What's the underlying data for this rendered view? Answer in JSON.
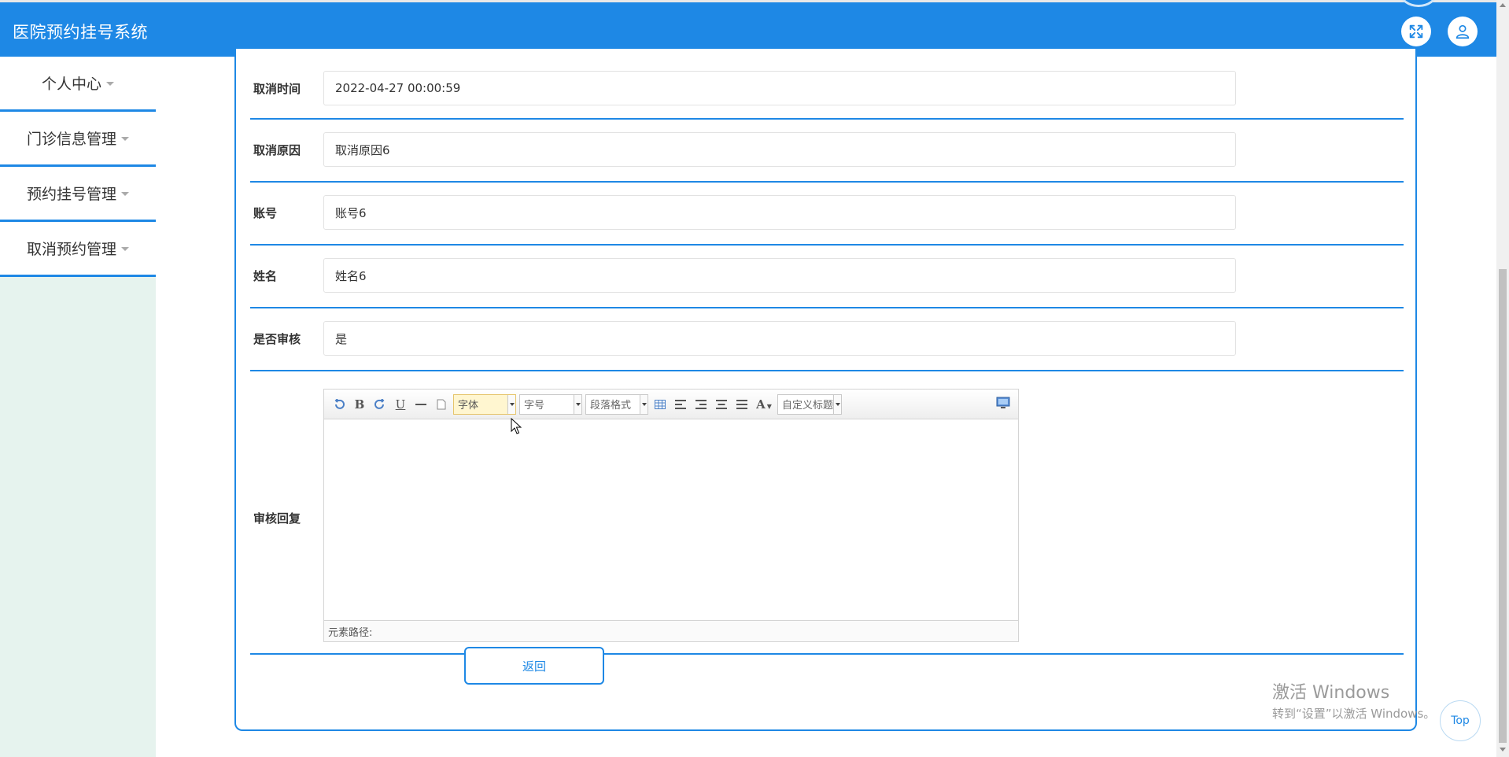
{
  "header": {
    "title": "医院预约挂号系统",
    "color": "#1e88e5",
    "icons": [
      "expand-icon",
      "user-icon"
    ]
  },
  "sidebar": {
    "items": [
      {
        "label": "个人中心"
      },
      {
        "label": "门诊信息管理"
      },
      {
        "label": "预约挂号管理"
      },
      {
        "label": "取消预约管理"
      }
    ]
  },
  "form": {
    "fields": [
      {
        "label": "取消时间",
        "value": "2022-04-27 00:00:59"
      },
      {
        "label": "取消原因",
        "value": "取消原因6"
      },
      {
        "label": "账号",
        "value": "账号6"
      },
      {
        "label": "姓名",
        "value": "姓名6"
      },
      {
        "label": "是否审核",
        "value": "是"
      }
    ],
    "reply": {
      "label": "审核回复",
      "toolbar": {
        "font_family": "字体",
        "font_size": "字号",
        "paragraph": "段落格式",
        "custom_title": "自定义标题"
      },
      "status": "元素路径:"
    },
    "back_label": "返回"
  },
  "watermark": {
    "line1": "激活 Windows",
    "line2": "转到“设置”以激活 Windows。"
  },
  "top_label": "Top"
}
